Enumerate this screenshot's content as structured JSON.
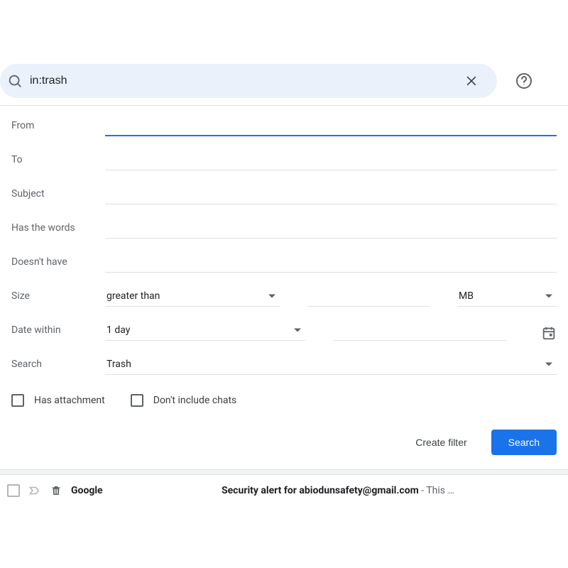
{
  "search": {
    "query": "in:trash"
  },
  "labels": {
    "from": "From",
    "to": "To",
    "subject": "Subject",
    "has_words": "Has the words",
    "doesnt_have": "Doesn't have",
    "size": "Size",
    "date_within": "Date within",
    "search_in": "Search"
  },
  "selects": {
    "size_op": "greater than",
    "size_unit": "MB",
    "date_range": "1 day",
    "search_location": "Trash"
  },
  "checks": {
    "has_attachment": "Has attachment",
    "exclude_chats": "Don't include chats"
  },
  "actions": {
    "create_filter": "Create filter",
    "search": "Search"
  },
  "mail": {
    "sender": "Google",
    "subject": "Security alert for abiodunsafety@gmail.com",
    "snippet_sep": " - ",
    "snippet": "This …"
  }
}
